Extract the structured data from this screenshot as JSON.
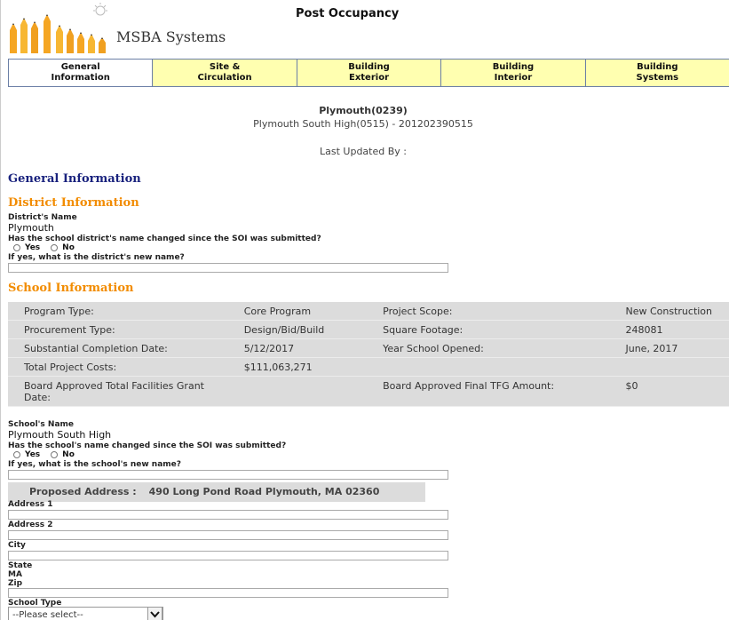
{
  "header": {
    "logo_text": "MSBA Systems",
    "title": "Post Occupancy"
  },
  "tabs": [
    {
      "line1": "General",
      "line2": "Information"
    },
    {
      "line1": "Site &",
      "line2": "Circulation"
    },
    {
      "line1": "Building",
      "line2": "Exterior"
    },
    {
      "line1": "Building",
      "line2": "Interior"
    },
    {
      "line1": "Building",
      "line2": "Systems"
    }
  ],
  "project": {
    "district_code": "Plymouth(0239)",
    "school_code": "Plymouth South High(0515) - 201202390515",
    "last_updated": "Last Updated By :"
  },
  "general_information": {
    "title": "General Information"
  },
  "district": {
    "section_title": "District Information",
    "name_label": "District's Name",
    "name_value": "Plymouth",
    "changed_question": "Has the school district's name changed since the SOI was submitted?",
    "yes": "Yes",
    "no": "No",
    "new_name_label": "If yes, what is the district's new name?"
  },
  "school": {
    "section_title": "School Information",
    "rows": [
      {
        "l1": "Program Type:",
        "v1": "Core Program",
        "l2": "Project Scope:",
        "v2": "New Construction"
      },
      {
        "l1": "Procurement Type:",
        "v1": "Design/Bid/Build",
        "l2": "Square Footage:",
        "v2": "248081"
      },
      {
        "l1": "Substantial Completion Date:",
        "v1": "5/12/2017",
        "l2": "Year School Opened:",
        "v2": "June, 2017"
      },
      {
        "l1": "Total Project Costs:",
        "v1": "$111,063,271",
        "l2": "",
        "v2": ""
      },
      {
        "l1": "Board Approved Total Facilities Grant Date:",
        "v1": "",
        "l2": "Board Approved Final TFG Amount:",
        "v2": "$0"
      }
    ],
    "name_label": "School's Name",
    "name_value": "Plymouth South High",
    "changed_question": "Has the school's name changed since the SOI was submitted?",
    "yes": "Yes",
    "no": "No",
    "new_name_label": "If yes, what is the school's new name?",
    "proposed_address_label": "Proposed Address :",
    "proposed_address_value": "490 Long Pond Road Plymouth, MA 02360",
    "address1_label": "Address 1",
    "address2_label": "Address 2",
    "city_label": "City",
    "state_label": "State",
    "state_value": "MA",
    "zip_label": "Zip",
    "school_type_label": "School Type",
    "school_type_selected": "--Please select--"
  }
}
